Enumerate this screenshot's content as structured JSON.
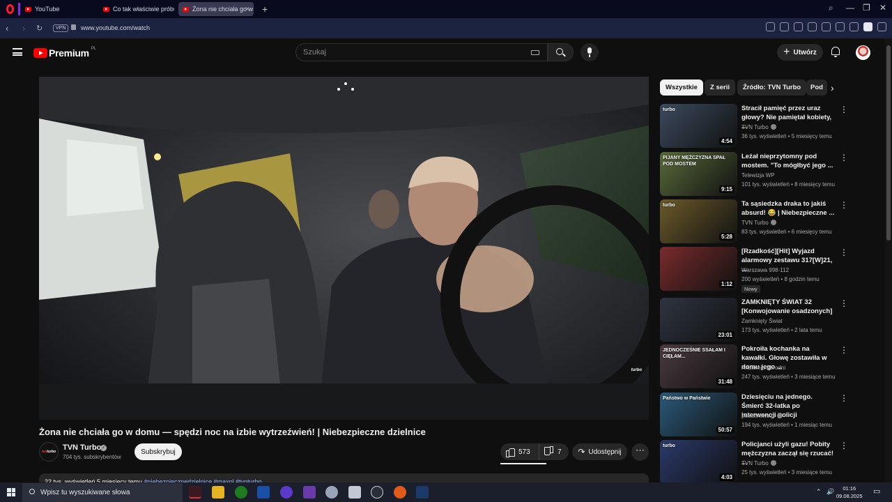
{
  "browser": {
    "tabs": [
      {
        "label": "YouTube",
        "active": false
      },
      {
        "label": "Co tak właściwie próbuje",
        "active": false
      },
      {
        "label": "Żona nie chciała go w",
        "active": true
      }
    ],
    "url": "www.youtube.com/watch",
    "vpn_label": "VPN"
  },
  "header": {
    "brand": "Premium",
    "country": "PL",
    "search_placeholder": "Szukaj",
    "create_label": "Utwórz"
  },
  "video": {
    "title": "Żona nie chciała go w domu — spędzi noc na izbie wytrzeźwień! | Niebezpieczne dzielnice",
    "channel": "TVN Turbo",
    "subscribers": "704 tys. subskrybentów",
    "subscribe_label": "Subskrybuj",
    "likes": "573",
    "dislikes": "7",
    "share_label": "Udostępnij",
    "description_meta": "22 tys. wyświetleń  5 miesięcy temu",
    "description_tags": "#niebezpiecznedzielnice #maxpl #tvnturbo",
    "watermark": "turbo"
  },
  "chips": [
    {
      "label": "Wszystkie",
      "active": true
    },
    {
      "label": "Z serii",
      "active": false
    },
    {
      "label": "Źródło: TVN Turbo",
      "active": false
    },
    {
      "label": "Pod",
      "active": false
    }
  ],
  "recommendations": [
    {
      "title": "Stracił pamięć przez uraz głowy? Nie pamiętał kobiety, ...",
      "channel": "TVN Turbo",
      "verified": true,
      "meta": "36 tys. wyświetleń • 5 miesięcy temu",
      "duration": "4:54",
      "thumb_color": "#3b4a5e",
      "thumb_label": "turbo"
    },
    {
      "title": "Leżał nieprzytomny pod mostem. \"To mógłbyć jego ...",
      "channel": "Telewizja WP",
      "verified": false,
      "meta": "101 tys. wyświetleń • 8 miesięcy temu",
      "duration": "9:15",
      "thumb_color": "#5a6b3a",
      "thumb_label": "PIJANY MĘŻCZYZNA SPAŁ POD MOSTEM"
    },
    {
      "title": "Ta sąsiedzka draka to jakiś absurd! 😂 | Niebezpieczne ...",
      "channel": "TVN Turbo",
      "verified": true,
      "meta": "83 tys. wyświetleń • 6 miesięcy temu",
      "duration": "5:28",
      "thumb_color": "#6b5a2a",
      "thumb_label": "turbo"
    },
    {
      "title": "[Rzadkość][Hit] Wyjazd alarmowy zestawu 317[W]21, ...",
      "channel": "Warszawa 998-112",
      "verified": false,
      "meta": "200 wyświetleń • 8 godzin temu",
      "duration": "1:12",
      "badge": "Nowy",
      "thumb_color": "#7a2b2b",
      "thumb_label": ""
    },
    {
      "title": "ZAMKNIĘTY ŚWIAT 32 [Konwojowanie osadzonych]",
      "channel": "Zamknięty Świat",
      "verified": false,
      "meta": "173 tys. wyświetleń • 2 lata temu",
      "duration": "23:01",
      "thumb_color": "#2e3440",
      "thumb_label": ""
    },
    {
      "title": "Pokroiła kochanka na kawałki. Głowę zostawiła w domu jego ...",
      "channel": "Anatomia Zbrodni",
      "verified": false,
      "meta": "247 tys. wyświetleń • 3 miesiące temu",
      "duration": "31:48",
      "thumb_color": "#4a3a40",
      "thumb_label": "JEDNOCZEŚNIE SSAŁAM I CIĘŁAM..."
    },
    {
      "title": "Dziesięciu na jednego. Śmierć 32-latka po interwencji policji",
      "channel": "polsatnews.pl",
      "verified": true,
      "meta": "194 tys. wyświetleń • 1 miesiąc temu",
      "duration": "50:57",
      "thumb_color": "#2a5a7a",
      "thumb_label": "Państwo w Państwie"
    },
    {
      "title": "Policjanci użyli gazu! Pobity mężczyzna zaczął się rzucać! ...",
      "channel": "TVN Turbo",
      "verified": true,
      "meta": "25 tys. wyświetleń • 3 miesiące temu",
      "duration": "4:03",
      "thumb_color": "#2a3a6a",
      "thumb_label": "turbo"
    }
  ],
  "taskbar": {
    "search_placeholder": "Wpisz tu wyszukiwane słowa",
    "time": "01:16",
    "date": "09.08.2025"
  }
}
